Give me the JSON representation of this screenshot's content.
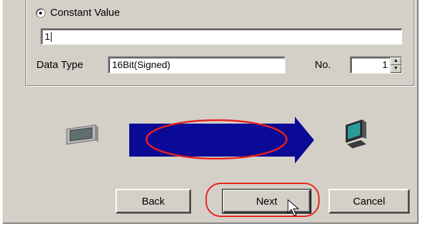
{
  "constant_value": {
    "radio_label": "Constant Value",
    "selected": true,
    "value": "1"
  },
  "data_type": {
    "label": "Data Type",
    "value": "16Bit(Signed)"
  },
  "number": {
    "label": "No.",
    "value": "1"
  },
  "buttons": {
    "back": "Back",
    "next": "Next",
    "cancel": "Cancel"
  },
  "icons": {
    "source": "display-panel-icon",
    "arrow": "transfer-arrow-icon",
    "target": "pc-monitor-icon",
    "cursor": "mouse-pointer-icon"
  },
  "colors": {
    "dialog_bg": "#d4d0c8",
    "arrow": "#0a0a96",
    "highlight": "#e8211b"
  }
}
